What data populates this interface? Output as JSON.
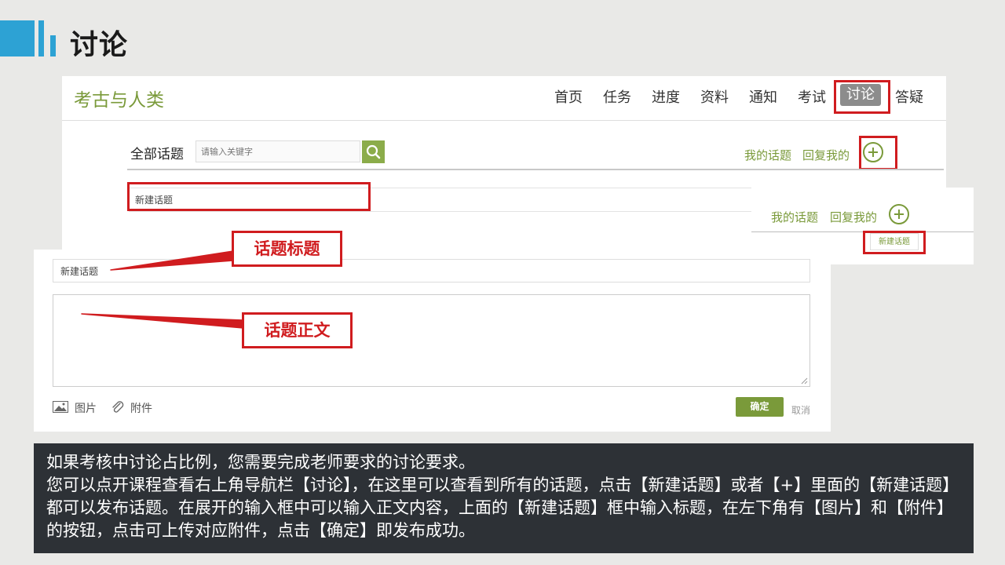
{
  "slide": {
    "title": "讨论"
  },
  "course": {
    "name": "考古与人类"
  },
  "nav": {
    "items": [
      "首页",
      "任务",
      "进度",
      "资料",
      "通知",
      "考试",
      "讨论",
      "答疑"
    ],
    "active": "讨论"
  },
  "toolbar": {
    "all_topics": "全部话题",
    "search_placeholder": "请输入关键字",
    "my_topics": "我的话题",
    "replied_me": "回复我的"
  },
  "topic": {
    "new_topic": "新建话题"
  },
  "right_overlay": {
    "my_topics": "我的话题",
    "replied_me": "回复我的",
    "new_topic_button": "新建话题"
  },
  "form": {
    "title_value": "新建话题",
    "image_label": "图片",
    "attach_label": "附件",
    "confirm_label": "确定",
    "cancel_label": "取消"
  },
  "callouts": {
    "title_callout": "话题标题",
    "body_callout": "话题正文"
  },
  "instructions": {
    "lines": [
      "如果考核中讨论占比例，您需要完成老师要求的讨论要求。",
      "您可以点开课程查看右上角导航栏【讨论】，在这里可以查看到所有的话题，点击【新建话题】或者【+】里面的【新建话题】都可以发布话题。在展开的输入框中可以输入正文内容，上面的【新建话题】框中输入标题，在左下角有【图片】和【附件】的按钮，点击可上传对应附件，点击【确定】即发布成功。"
    ]
  },
  "colors": {
    "accent_blue": "#2da2d4",
    "brand_green": "#7a9a3a",
    "highlight_red": "#d01c1f",
    "info_bg": "#2d3136"
  }
}
